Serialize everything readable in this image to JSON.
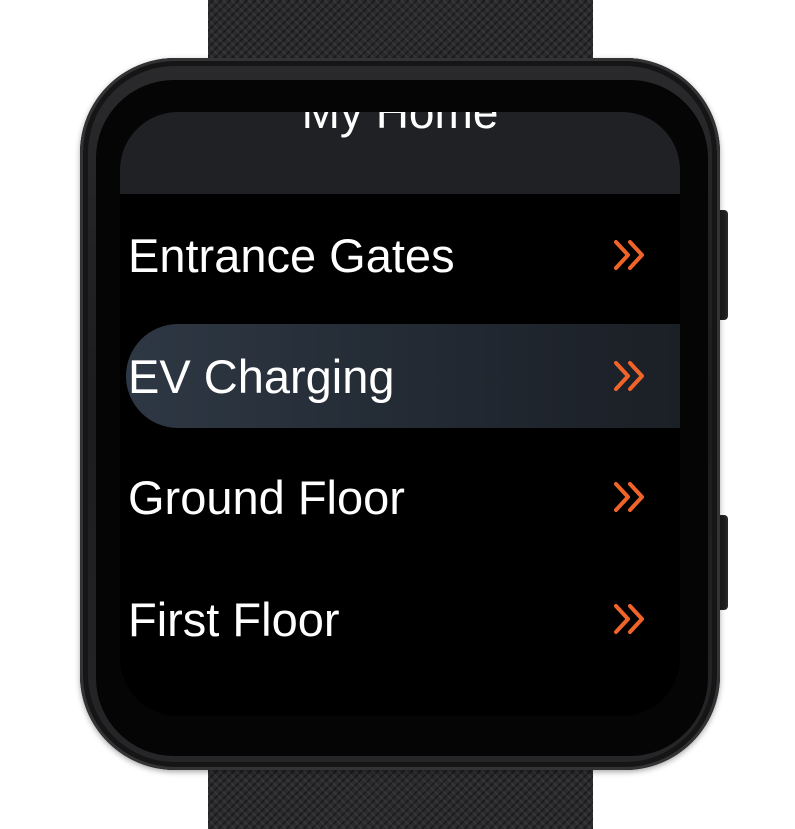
{
  "screen": {
    "header": {
      "title": "My Home"
    },
    "items": [
      {
        "label": "Entrance Gates",
        "icon": "chevron-double-right-icon",
        "selected": false
      },
      {
        "label": "EV Charging",
        "icon": "chevron-double-right-icon",
        "selected": true
      },
      {
        "label": "Ground Floor",
        "icon": "chevron-double-right-icon",
        "selected": false
      },
      {
        "label": "First Floor",
        "icon": "chevron-double-right-icon",
        "selected": false
      }
    ]
  },
  "colors": {
    "accent": "#f0642a",
    "screen_background": "#000000",
    "selected_background": "#2a323d",
    "header_background": "#202124",
    "text": "#ffffff"
  }
}
